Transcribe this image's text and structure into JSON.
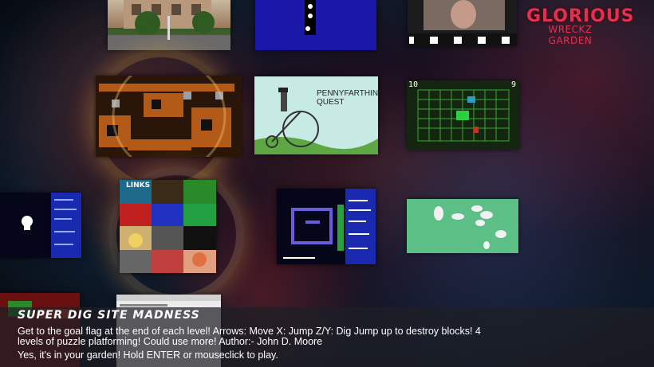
{
  "garden": {
    "logo_top": "GLORIOUS",
    "logo_bottom": "WRECKZ GARDEN"
  },
  "thumbnails": {
    "penny": {
      "title_line1": "PENNYFARTHING",
      "title_line2": "QUEST"
    },
    "grid": {
      "left_number": "10",
      "right_number": "9"
    },
    "mosaic": {
      "link_label": "LINKS"
    }
  },
  "selected_game": {
    "title": "SUPER DIG SITE MADNESS",
    "description": "Get to the goal flag at the end of each level! Arrows: Move X: Jump Z/Y: Dig Jump up to destroy blocks! 4 levels of puzzle platforming! Could use more! Author:- John D. Moore",
    "hint": "Yes, it's in your garden! Hold ENTER or mouseclick to play."
  },
  "colors": {
    "logo": "#e23050",
    "panel": "#1e1e26"
  }
}
